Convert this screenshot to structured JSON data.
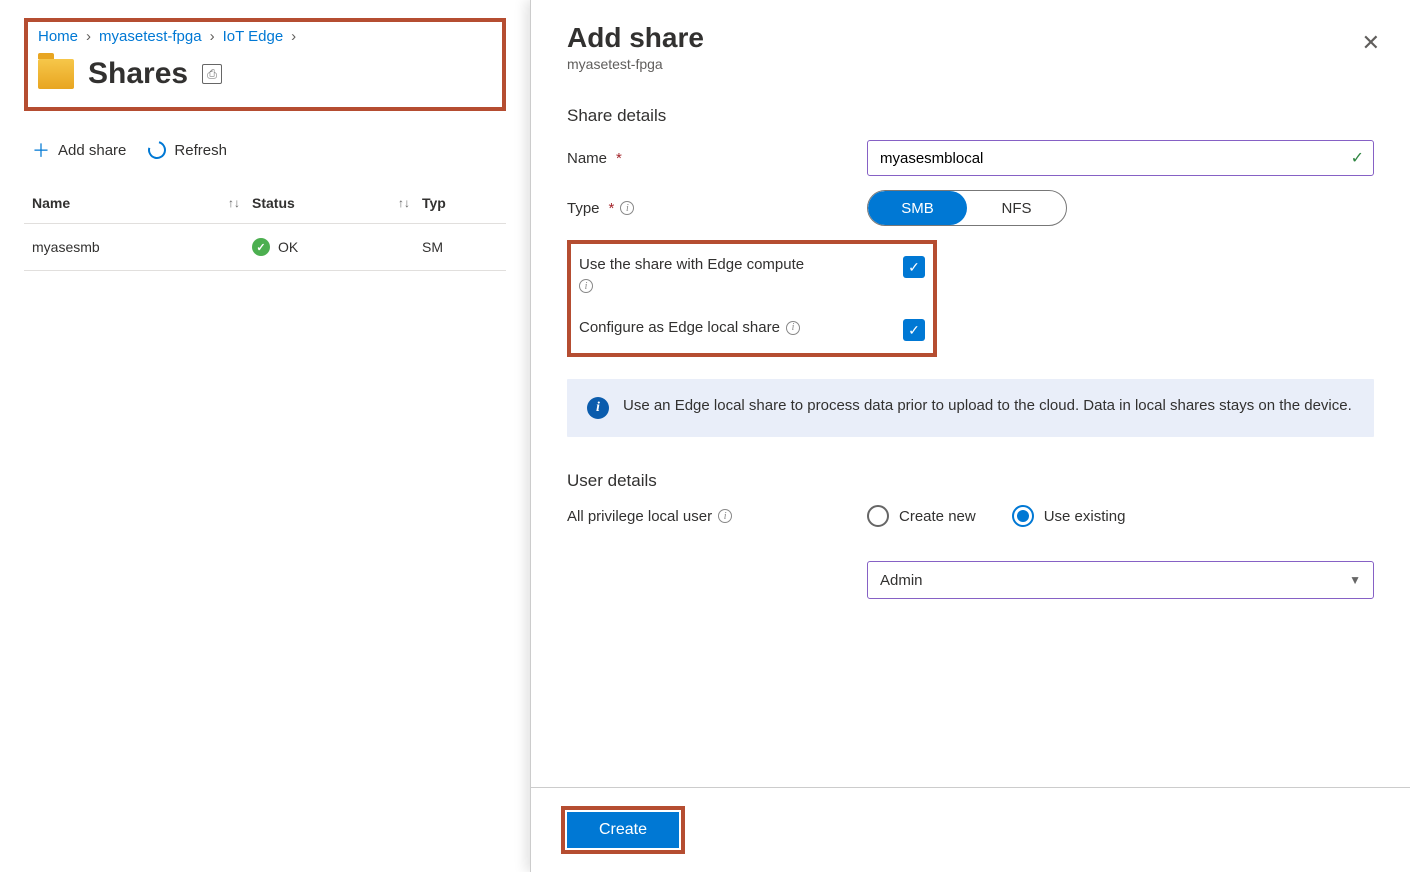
{
  "breadcrumb": {
    "items": [
      {
        "label": "Home"
      },
      {
        "label": "myasetest-fpga"
      },
      {
        "label": "IoT Edge"
      }
    ]
  },
  "page_title": "Shares",
  "toolbar": {
    "add_share": "Add share",
    "refresh": "Refresh"
  },
  "table": {
    "headers": {
      "name": "Name",
      "status": "Status",
      "type": "Typ"
    },
    "rows": [
      {
        "name": "myasesmb",
        "status": "OK",
        "type": "SM"
      }
    ]
  },
  "panel": {
    "title": "Add share",
    "subtitle": "myasetest-fpga",
    "sections": {
      "share_details": "Share details",
      "user_details": "User details"
    },
    "labels": {
      "name": "Name",
      "type": "Type",
      "use_edge": "Use the share with Edge compute",
      "config_local": "Configure as Edge local share",
      "local_user": "All privilege local user"
    },
    "name_value": "myasesmblocal",
    "type_options": {
      "smb": "SMB",
      "nfs": "NFS"
    },
    "info_text": "Use an Edge local share to process data prior to upload to the cloud. Data in local shares stays on the device.",
    "user_radio": {
      "create": "Create new",
      "existing": "Use existing"
    },
    "user_select": "Admin",
    "create_btn": "Create"
  }
}
